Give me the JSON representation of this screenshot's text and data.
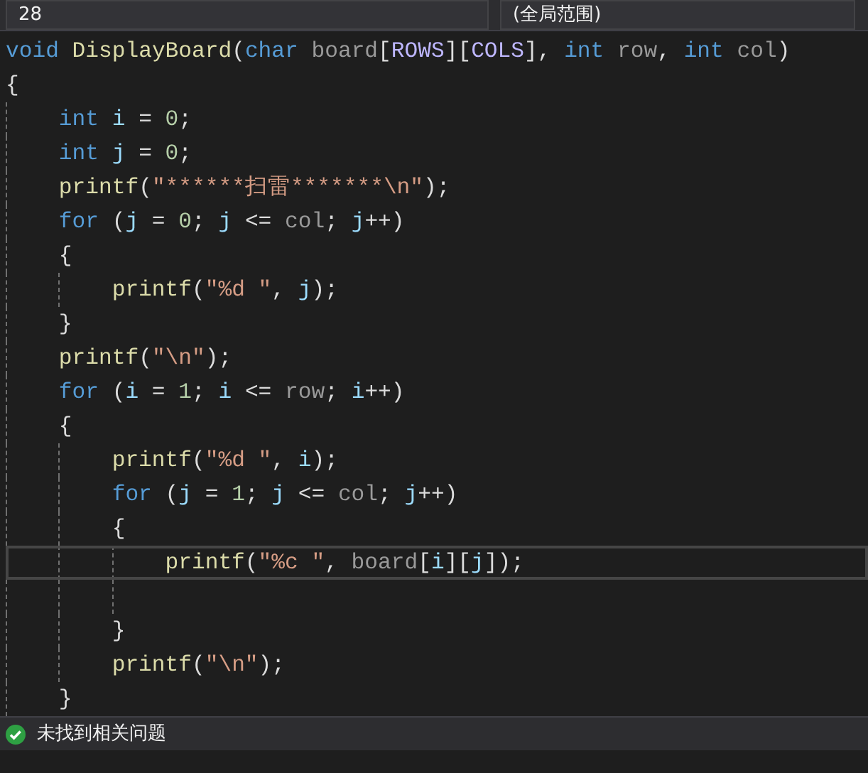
{
  "navigation_bar": {
    "project": "28",
    "scope": "(全局范围)"
  },
  "lines": [
    {
      "tokens": [
        {
          "kind": "keyword",
          "text": "void "
        },
        {
          "kind": "function",
          "text": "DisplayBoard"
        },
        {
          "kind": "plain",
          "text": "("
        },
        {
          "kind": "keyword",
          "text": "char "
        },
        {
          "kind": "param",
          "text": "board"
        },
        {
          "kind": "plain",
          "text": "["
        },
        {
          "kind": "macro",
          "text": "ROWS"
        },
        {
          "kind": "plain",
          "text": "]["
        },
        {
          "kind": "macro",
          "text": "COLS"
        },
        {
          "kind": "plain",
          "text": "], "
        },
        {
          "kind": "keyword",
          "text": "int "
        },
        {
          "kind": "param",
          "text": "row"
        },
        {
          "kind": "plain",
          "text": ", "
        },
        {
          "kind": "keyword",
          "text": "int "
        },
        {
          "kind": "param",
          "text": "col"
        },
        {
          "kind": "plain",
          "text": ")"
        }
      ],
      "current": false
    },
    {
      "tokens": [
        {
          "kind": "plain",
          "text": "{"
        }
      ],
      "current": false,
      "children": [
        {
          "tokens": [
            {
              "kind": "keyword",
              "text": "int "
            },
            {
              "kind": "local",
              "text": "i"
            },
            {
              "kind": "plain",
              "text": " = "
            },
            {
              "kind": "number",
              "text": "0"
            },
            {
              "kind": "plain",
              "text": ";"
            }
          ],
          "current": false
        },
        {
          "tokens": [
            {
              "kind": "keyword",
              "text": "int "
            },
            {
              "kind": "local",
              "text": "j"
            },
            {
              "kind": "plain",
              "text": " = "
            },
            {
              "kind": "number",
              "text": "0"
            },
            {
              "kind": "plain",
              "text": ";"
            }
          ],
          "current": false
        },
        {
          "tokens": [
            {
              "kind": "function",
              "text": "printf"
            },
            {
              "kind": "plain",
              "text": "("
            },
            {
              "kind": "string",
              "text": "\"******扫雷*******\\n\""
            },
            {
              "kind": "plain",
              "text": ");"
            }
          ],
          "current": false
        },
        {
          "tokens": [
            {
              "kind": "keyword",
              "text": "for"
            },
            {
              "kind": "plain",
              "text": " ("
            },
            {
              "kind": "local",
              "text": "j"
            },
            {
              "kind": "plain",
              "text": " = "
            },
            {
              "kind": "number",
              "text": "0"
            },
            {
              "kind": "plain",
              "text": "; "
            },
            {
              "kind": "local",
              "text": "j"
            },
            {
              "kind": "plain",
              "text": " <= "
            },
            {
              "kind": "param",
              "text": "col"
            },
            {
              "kind": "plain",
              "text": "; "
            },
            {
              "kind": "local",
              "text": "j"
            },
            {
              "kind": "plain",
              "text": "++)"
            }
          ],
          "current": false
        },
        {
          "tokens": [
            {
              "kind": "plain",
              "text": "{"
            }
          ],
          "current": false,
          "children": [
            {
              "tokens": [
                {
                  "kind": "function",
                  "text": "printf"
                },
                {
                  "kind": "plain",
                  "text": "("
                },
                {
                  "kind": "string",
                  "text": "\"%d \""
                },
                {
                  "kind": "plain",
                  "text": ", "
                },
                {
                  "kind": "local",
                  "text": "j"
                },
                {
                  "kind": "plain",
                  "text": ");"
                }
              ],
              "current": false
            }
          ]
        },
        {
          "tokens": [
            {
              "kind": "plain",
              "text": "}"
            }
          ],
          "current": false
        },
        {
          "tokens": [
            {
              "kind": "function",
              "text": "printf"
            },
            {
              "kind": "plain",
              "text": "("
            },
            {
              "kind": "string",
              "text": "\"\\n\""
            },
            {
              "kind": "plain",
              "text": ");"
            }
          ],
          "current": false
        },
        {
          "tokens": [
            {
              "kind": "keyword",
              "text": "for"
            },
            {
              "kind": "plain",
              "text": " ("
            },
            {
              "kind": "local",
              "text": "i"
            },
            {
              "kind": "plain",
              "text": " = "
            },
            {
              "kind": "number",
              "text": "1"
            },
            {
              "kind": "plain",
              "text": "; "
            },
            {
              "kind": "local",
              "text": "i"
            },
            {
              "kind": "plain",
              "text": " <= "
            },
            {
              "kind": "param",
              "text": "row"
            },
            {
              "kind": "plain",
              "text": "; "
            },
            {
              "kind": "local",
              "text": "i"
            },
            {
              "kind": "plain",
              "text": "++)"
            }
          ],
          "current": false
        },
        {
          "tokens": [
            {
              "kind": "plain",
              "text": "{"
            }
          ],
          "current": false,
          "children": [
            {
              "tokens": [
                {
                  "kind": "function",
                  "text": "printf"
                },
                {
                  "kind": "plain",
                  "text": "("
                },
                {
                  "kind": "string",
                  "text": "\"%d \""
                },
                {
                  "kind": "plain",
                  "text": ", "
                },
                {
                  "kind": "local",
                  "text": "i"
                },
                {
                  "kind": "plain",
                  "text": ");"
                }
              ],
              "current": false
            },
            {
              "tokens": [
                {
                  "kind": "keyword",
                  "text": "for"
                },
                {
                  "kind": "plain",
                  "text": " ("
                },
                {
                  "kind": "local",
                  "text": "j"
                },
                {
                  "kind": "plain",
                  "text": " = "
                },
                {
                  "kind": "number",
                  "text": "1"
                },
                {
                  "kind": "plain",
                  "text": "; "
                },
                {
                  "kind": "local",
                  "text": "j"
                },
                {
                  "kind": "plain",
                  "text": " <= "
                },
                {
                  "kind": "param",
                  "text": "col"
                },
                {
                  "kind": "plain",
                  "text": "; "
                },
                {
                  "kind": "local",
                  "text": "j"
                },
                {
                  "kind": "plain",
                  "text": "++)"
                }
              ],
              "current": false
            },
            {
              "tokens": [
                {
                  "kind": "plain",
                  "text": "{"
                }
              ],
              "current": false,
              "children": [
                {
                  "tokens": [
                    {
                      "kind": "function",
                      "text": "printf"
                    },
                    {
                      "kind": "plain",
                      "text": "("
                    },
                    {
                      "kind": "string",
                      "text": "\"%c \""
                    },
                    {
                      "kind": "plain",
                      "text": ", "
                    },
                    {
                      "kind": "param",
                      "text": "board"
                    },
                    {
                      "kind": "plain",
                      "text": "["
                    },
                    {
                      "kind": "local",
                      "text": "i"
                    },
                    {
                      "kind": "plain",
                      "text": "]["
                    },
                    {
                      "kind": "local",
                      "text": "j"
                    },
                    {
                      "kind": "plain",
                      "text": "]);"
                    }
                  ],
                  "current": true
                },
                {
                  "current": false
                }
              ]
            },
            {
              "tokens": [
                {
                  "kind": "plain",
                  "text": "}"
                }
              ],
              "current": false
            },
            {
              "tokens": [
                {
                  "kind": "function",
                  "text": "printf"
                },
                {
                  "kind": "plain",
                  "text": "("
                },
                {
                  "kind": "string",
                  "text": "\"\\n\""
                },
                {
                  "kind": "plain",
                  "text": ");"
                }
              ],
              "current": false
            }
          ]
        },
        {
          "tokens": [
            {
              "kind": "plain",
              "text": "}"
            }
          ],
          "current": false
        }
      ]
    }
  ],
  "status_bar": {
    "issues": "未找到相关问题"
  }
}
